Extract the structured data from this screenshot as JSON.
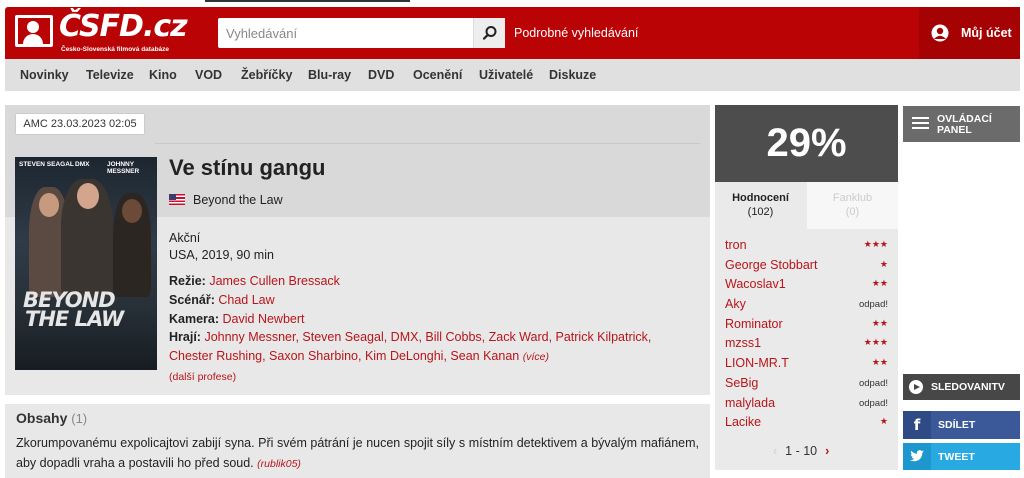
{
  "header": {
    "logo_text": "ČSFD.cz",
    "logo_subtitle": "Česko-Slovenská filmová databáze",
    "search_placeholder": "Vyhledávání",
    "advanced_search": "Podrobné vyhledávání",
    "account_label": "Můj účet"
  },
  "nav": {
    "items": [
      "Novinky",
      "Televize",
      "Kino",
      "VOD",
      "Žebříčky",
      "Blu-ray",
      "DVD",
      "Ocenění",
      "Uživatelé",
      "Diskuze"
    ]
  },
  "film": {
    "date_badge": "AMC 23.03.2023 02:05",
    "title": "Ve stínu gangu",
    "original_title": "Beyond the Law",
    "genre": "Akční",
    "origin": "USA, 2019, 90 min",
    "director_label": "Režie:",
    "director": "James Cullen Bressack",
    "writer_label": "Scénář:",
    "writer": "Chad Law",
    "camera_label": "Kamera:",
    "camera": "David Newbert",
    "cast_label": "Hrají:",
    "cast_line1": "Johnny Messner, Steven Seagal, DMX, Bill Cobbs, Zack Ward, Patrick Kilpatrick,",
    "cast_line2": "Chester Rushing, Saxon Sharbino, Kim DeLonghi, Sean Kanan",
    "more_cast": "(více)",
    "more_professions": "(další profese)",
    "poster": {
      "actor1": "STEVEN SEAGAL",
      "actor2": "DMX",
      "actor3": "JOHNNY MESSNER",
      "title_line1": "BEYOND",
      "title_line2": "THE LAW"
    }
  },
  "synopsis": {
    "title": "Obsahy",
    "count": "(1)",
    "text": "Zkorumpovanému expolicajtovi zabijí syna. Při svém pátrání je nucen spojit síly s místním detektivem a bývalým mafiánem, aby dopadli vraha a postavili ho před soud.",
    "author": "(rublik05)"
  },
  "rating": {
    "percent": "29%",
    "tab_ratings": "Hodnocení",
    "tab_ratings_count": "(102)",
    "tab_fanclub": "Fanklub",
    "tab_fanclub_count": "(0)",
    "users": [
      {
        "name": "tron",
        "mark": "★★★"
      },
      {
        "name": "George Stobbart",
        "mark": "★"
      },
      {
        "name": "Wacoslav1",
        "mark": "★★"
      },
      {
        "name": "Aky",
        "mark": "odpad!"
      },
      {
        "name": "Rominator",
        "mark": "★★"
      },
      {
        "name": "mzss1",
        "mark": "★★★"
      },
      {
        "name": "LION-MR.T",
        "mark": "★★"
      },
      {
        "name": "SeBig",
        "mark": "odpad!"
      },
      {
        "name": "malylada",
        "mark": "odpad!"
      },
      {
        "name": "Lacike",
        "mark": "★"
      }
    ],
    "pager": "1 - 10",
    "pager_prev": "‹",
    "pager_next": "›"
  },
  "sidebar": {
    "control_panel_line1": "OVLÁDACÍ",
    "control_panel_line2": "PANEL",
    "watch": "SLEDOVANITV",
    "share": "SDÍLET",
    "share_icon": "f",
    "tweet": "TWEET"
  },
  "colors": {
    "brand_red": "#ba0305",
    "link_red": "#b8151a",
    "facebook": "#3b5998",
    "twitter": "#29a9e1"
  }
}
